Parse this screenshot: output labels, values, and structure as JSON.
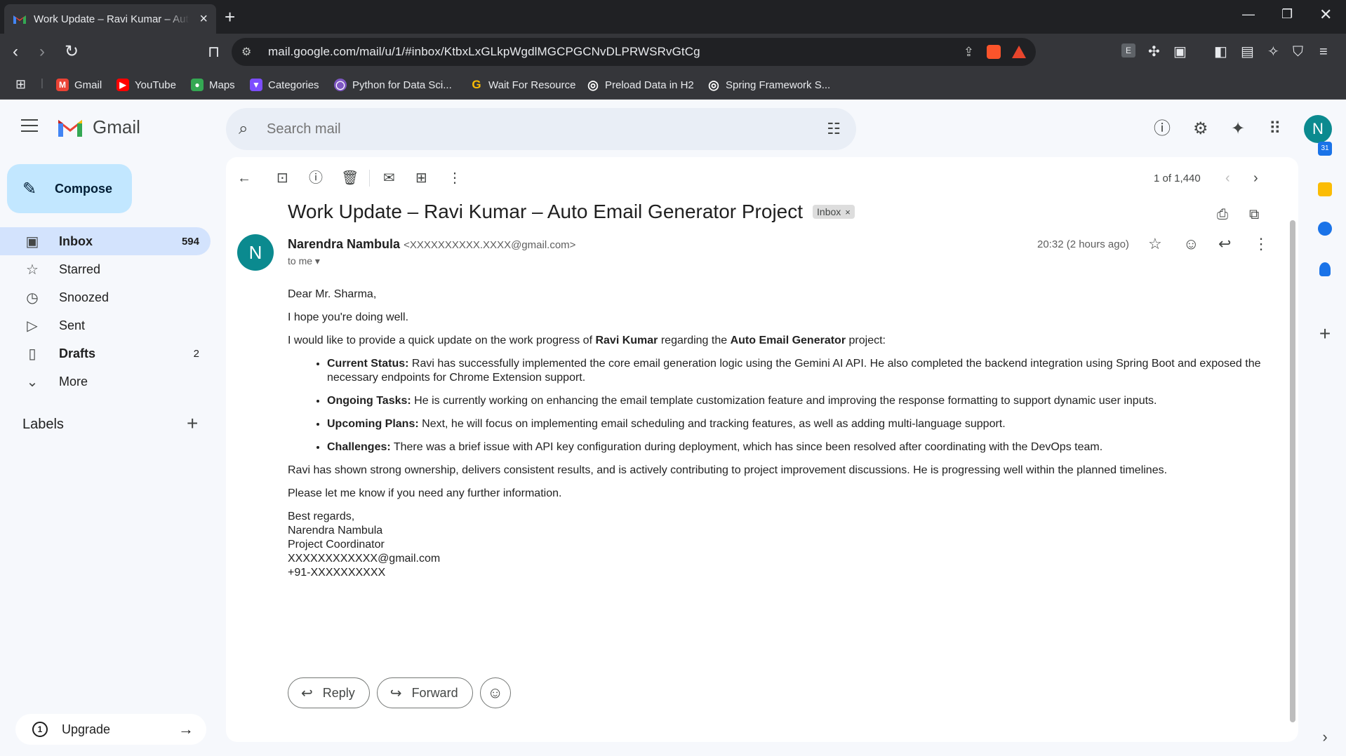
{
  "browser": {
    "tab_title": "Work Update – Ravi Kumar – Auto Email Generator Project",
    "url": "mail.google.com/mail/u/1/#inbox/KtbxLxGLkpWgdlMGCPGCNvDLPRWSRvGtCg",
    "bookmarks": [
      {
        "label": "Gmail",
        "color": "#ea4335",
        "glyph": "M"
      },
      {
        "label": "YouTube",
        "color": "#ff0000",
        "glyph": "▶"
      },
      {
        "label": "Maps",
        "color": "#34a853",
        "glyph": "●"
      },
      {
        "label": "Categories",
        "color": "#7c4dff",
        "glyph": "▼"
      },
      {
        "label": "Python for Data Sci...",
        "color": "#7e57c2",
        "glyph": "◯"
      },
      {
        "label": "Wait For Resource",
        "color": "#fbbc04",
        "glyph": "G"
      },
      {
        "label": "Preload Data in H2",
        "color": "#5f6368",
        "glyph": "◎"
      },
      {
        "label": "Spring Framework S...",
        "color": "#5f6368",
        "glyph": "◎"
      }
    ]
  },
  "gmail": {
    "brand": "Gmail",
    "search_placeholder": "Search mail",
    "avatar_letter": "N",
    "compose_label": "Compose",
    "nav": [
      {
        "label": "Inbox",
        "count": "594",
        "icon": "inbox-icon",
        "glyph": "▣",
        "active": true,
        "bold": true
      },
      {
        "label": "Starred",
        "count": "",
        "icon": "star-icon",
        "glyph": "☆",
        "active": false,
        "bold": false
      },
      {
        "label": "Snoozed",
        "count": "",
        "icon": "clock-icon",
        "glyph": "◷",
        "active": false,
        "bold": false
      },
      {
        "label": "Sent",
        "count": "",
        "icon": "send-icon",
        "glyph": "▷",
        "active": false,
        "bold": false
      },
      {
        "label": "Drafts",
        "count": "2",
        "icon": "draft-icon",
        "glyph": "▯",
        "active": false,
        "bold": true
      },
      {
        "label": "More",
        "count": "",
        "icon": "chevron-down-icon",
        "glyph": "⌄",
        "active": false,
        "bold": false
      }
    ],
    "labels_heading": "Labels",
    "upgrade_label": "Upgrade"
  },
  "email": {
    "page_count": "1 of 1,440",
    "subject": "Work Update – Ravi Kumar – Auto Email Generator Project",
    "badge": "Inbox",
    "sender_initial": "N",
    "sender_name": "Narendra Nambula",
    "sender_email": "<XXXXXXXXXX.XXXX@gmail.com>",
    "to_me": "to me",
    "time": "20:32 (2 hours ago)",
    "greeting": "Dear Mr. Sharma,",
    "line1": "I hope you're doing well.",
    "intro_a": "I would like to provide a quick update on the work progress of ",
    "intro_name": "Ravi Kumar",
    "intro_b": " regarding the ",
    "intro_project": "Auto Email Generator",
    "intro_c": " project:",
    "bullets": [
      {
        "head": "Current Status:",
        "text": " Ravi has successfully implemented the core email generation logic using the Gemini AI API. He also completed the backend integration using Spring Boot and exposed the necessary endpoints for Chrome Extension support."
      },
      {
        "head": "Ongoing Tasks:",
        "text": " He is currently working on enhancing the email template customization feature and improving the response formatting to support dynamic user inputs."
      },
      {
        "head": "Upcoming Plans:",
        "text": " Next, he will focus on implementing email scheduling and tracking features, as well as adding multi-language support."
      },
      {
        "head": "Challenges:",
        "text": " There was a brief issue with API key configuration during deployment, which has since been resolved after coordinating with the DevOps team."
      }
    ],
    "summary": "Ravi has shown strong ownership, delivers consistent results, and is actively contributing to project improvement discussions. He is progressing well within the planned timelines.",
    "closing_request": "Please let me know if you need any further information.",
    "signature": [
      "Best regards,",
      "Narendra Nambula",
      "Project Coordinator",
      "XXXXXXXXXXXX@gmail.com",
      "+91-XXXXXXXXXX"
    ],
    "reply_label": "Reply",
    "forward_label": "Forward"
  },
  "colors": {
    "accent": "#c2e7ff",
    "active_nav": "#d3e3fd",
    "avatar": "#0b8a8f"
  }
}
